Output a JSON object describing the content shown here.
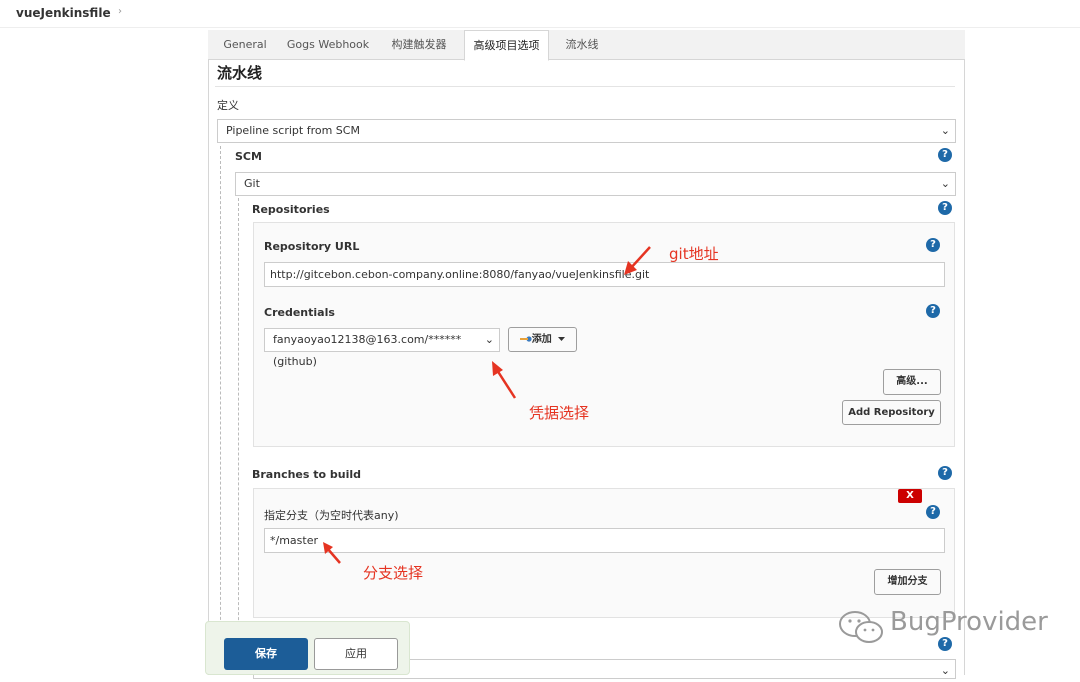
{
  "breadcrumb": {
    "job": "vueJenkinsfile",
    "separator": "›"
  },
  "tabs": [
    "General",
    "Gogs Webhook",
    "构建触发器",
    "高级项目选项",
    "流水线"
  ],
  "active_tab": "高级项目选项",
  "section_title": "流水线",
  "definition": {
    "label": "定义",
    "value": "Pipeline script from SCM"
  },
  "scm": {
    "label": "SCM",
    "value": "Git"
  },
  "repositories": {
    "label": "Repositories",
    "url_label": "Repository URL",
    "url_value": "http://gitcebon.cebon-company.online:8080/fanyao/vueJenkinsfile.git",
    "credentials_label": "Credentials",
    "credentials_value": "fanyaoyao12138@163.com/****** (github)",
    "add_button": "添加",
    "advanced_button": "高级...",
    "add_repo_button": "Add Repository"
  },
  "branches": {
    "label": "Branches to build",
    "delete_label": "X",
    "specifier_label": "指定分支（为空时代表any)",
    "specifier_value": "*/master",
    "add_branch_button": "增加分支"
  },
  "annotations": {
    "git": "git地址",
    "cred": "凭据选择",
    "branch": "分支选择"
  },
  "footer": {
    "save": "保存",
    "apply": "应用"
  },
  "watermark": "BugProvider",
  "help_glyph": "?",
  "caret_glyph": "⌄",
  "colors": {
    "accent": "#1e69a8",
    "annotation": "#e53422",
    "save": "#1c5d98",
    "delete": "#cc0000"
  }
}
